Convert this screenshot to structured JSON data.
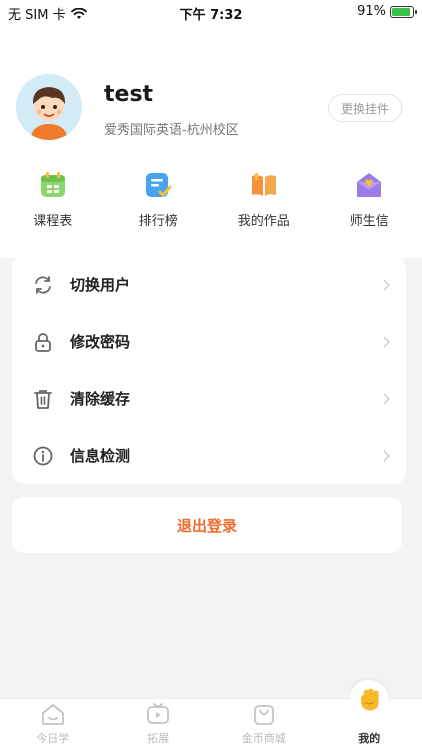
{
  "status_bar": {
    "carrier": "无 SIM 卡",
    "time": "下午 7:32",
    "battery_percent": "91%",
    "battery_level": 0.91
  },
  "profile": {
    "name": "test",
    "school": "爱秀国际英语-杭州校区",
    "change_pendant_label": "更换挂件"
  },
  "shortcuts": [
    {
      "label": "课程表",
      "icon": "calendar-icon"
    },
    {
      "label": "排行榜",
      "icon": "leaderboard-icon"
    },
    {
      "label": "我的作品",
      "icon": "book-icon"
    },
    {
      "label": "师生信",
      "icon": "letter-icon"
    }
  ],
  "menu": {
    "items": [
      {
        "label": "切换用户",
        "icon": "refresh-icon"
      },
      {
        "label": "修改密码",
        "icon": "lock-icon"
      },
      {
        "label": "清除缓存",
        "icon": "trash-icon"
      },
      {
        "label": "信息检测",
        "icon": "info-icon"
      }
    ],
    "logout_label": "退出登录"
  },
  "tabs": [
    {
      "label": "今日学",
      "icon": "home-icon",
      "active": false
    },
    {
      "label": "拓展",
      "icon": "tv-icon",
      "active": false
    },
    {
      "label": "金币商城",
      "icon": "shop-bag-icon",
      "active": false
    },
    {
      "label": "我的",
      "icon": "hand-icon",
      "active": true
    }
  ],
  "colors": {
    "accent": "#f06b2d",
    "background": "#f3f3f3"
  }
}
